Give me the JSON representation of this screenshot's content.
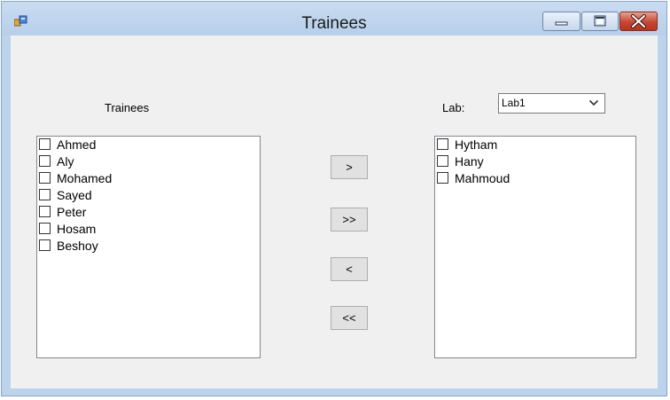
{
  "window": {
    "title": "Trainees"
  },
  "trainees_label": "Trainees",
  "lab_label": "Lab:",
  "lab_select": {
    "selected": "Lab1"
  },
  "trainees_list": [
    {
      "label": "Ahmed",
      "checked": false
    },
    {
      "label": "Aly",
      "checked": false
    },
    {
      "label": "Mohamed",
      "checked": false
    },
    {
      "label": "Sayed",
      "checked": false
    },
    {
      "label": "Peter",
      "checked": false
    },
    {
      "label": "Hosam",
      "checked": false
    },
    {
      "label": "Beshoy",
      "checked": false
    }
  ],
  "lab_list": [
    {
      "label": "Hytham",
      "checked": false
    },
    {
      "label": "Hany",
      "checked": false
    },
    {
      "label": "Mahmoud",
      "checked": false
    }
  ],
  "buttons": {
    "move_selected": ">",
    "move_all": ">>",
    "remove_selected": "<",
    "remove_all": "<<"
  }
}
